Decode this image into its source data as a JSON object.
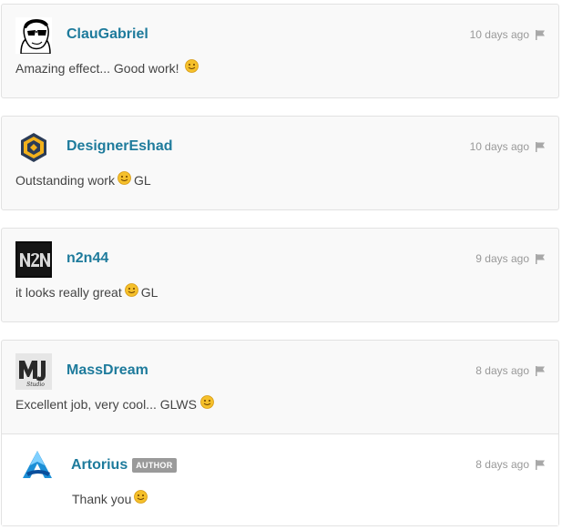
{
  "comments": [
    {
      "username": "ClauGabriel",
      "time": "10 days ago",
      "text_before": "Amazing effect... Good work!",
      "text_after": "",
      "avatar_icon": "sunglasses-face-avatar",
      "flag_icon": "flag-icon"
    },
    {
      "username": "DesignerEshad",
      "time": "10 days ago",
      "text_before": "Outstanding work",
      "text_after": "GL",
      "avatar_icon": "hexagon-logo-avatar",
      "flag_icon": "flag-icon"
    },
    {
      "username": "n2n44",
      "time": "9 days ago",
      "text_before": "it looks really great",
      "text_after": "GL",
      "avatar_icon": "n2n-logo-avatar",
      "flag_icon": "flag-icon"
    },
    {
      "username": "MassDream",
      "time": "8 days ago",
      "text_before": "Excellent job, very cool... GLWS",
      "text_after": "",
      "avatar_icon": "mj-studio-logo-avatar",
      "flag_icon": "flag-icon"
    }
  ],
  "reply": {
    "username": "Artorius",
    "badge": "AUTHOR",
    "time": "8 days ago",
    "text_before": "Thank you",
    "text_after": "",
    "avatar_icon": "blue-a-logo-avatar",
    "flag_icon": "flag-icon"
  },
  "colors": {
    "username": "#1e7b9c",
    "card_background": "#f9f9f9",
    "border": "#e2e2e2",
    "badge_background": "#9a9a9a",
    "smiley": "#f5c02b"
  }
}
